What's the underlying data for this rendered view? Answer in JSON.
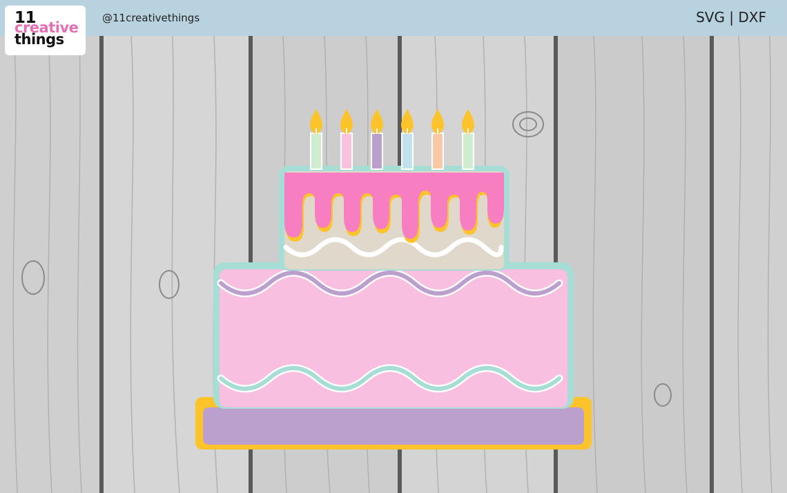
{
  "header": {
    "logo_lines": [
      "11",
      "creative",
      "things"
    ],
    "handle": "@11creativethings",
    "formats": "SVG | DXF"
  },
  "colors": {
    "header_bg": "#b8d2df",
    "logo_pink": "#e36fb4",
    "frosting_pink": "#f77fc1",
    "cake_pink": "#f9bfe0",
    "mint": "#a6ddd4",
    "lavender": "#bb9fcc",
    "gold": "#fcc42a",
    "cream": "#e0d8cb"
  },
  "candles": [
    {
      "color": "#cfeccf"
    },
    {
      "color": "#f8c2de"
    },
    {
      "color": "#bb9fcc"
    },
    {
      "color": "#bfe2ee"
    },
    {
      "color": "#f9c9a6"
    },
    {
      "color": "#cfeccf"
    }
  ]
}
